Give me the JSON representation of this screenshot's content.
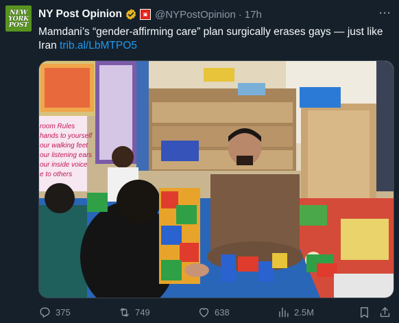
{
  "tweet": {
    "avatar_lines": [
      "NEW",
      "YORK",
      "POST"
    ],
    "account_name": "NY Post Opinion",
    "handle": "@NYPostOpinion",
    "separator": "·",
    "time": "17h",
    "more_label": "···",
    "text": "Mamdani’s “gender-affirming care” plan surgically erases gays — just like Iran",
    "link": "trib.al/LbMTPO5"
  },
  "media": {
    "poster_lines": [
      "room Rules",
      "hands to yourself",
      "our walking feet",
      "our listening ears",
      "our inside voice",
      "e to others"
    ]
  },
  "actions": {
    "replies": "375",
    "reposts": "749",
    "likes": "638",
    "views": "2.5M"
  },
  "colors": {
    "background": "#15202b",
    "text": "#f7f9f9",
    "secondary": "#8b98a5",
    "link": "#1d9bf0",
    "verified_badge": "#e8b51f",
    "avatar_bg": "#58941f"
  }
}
